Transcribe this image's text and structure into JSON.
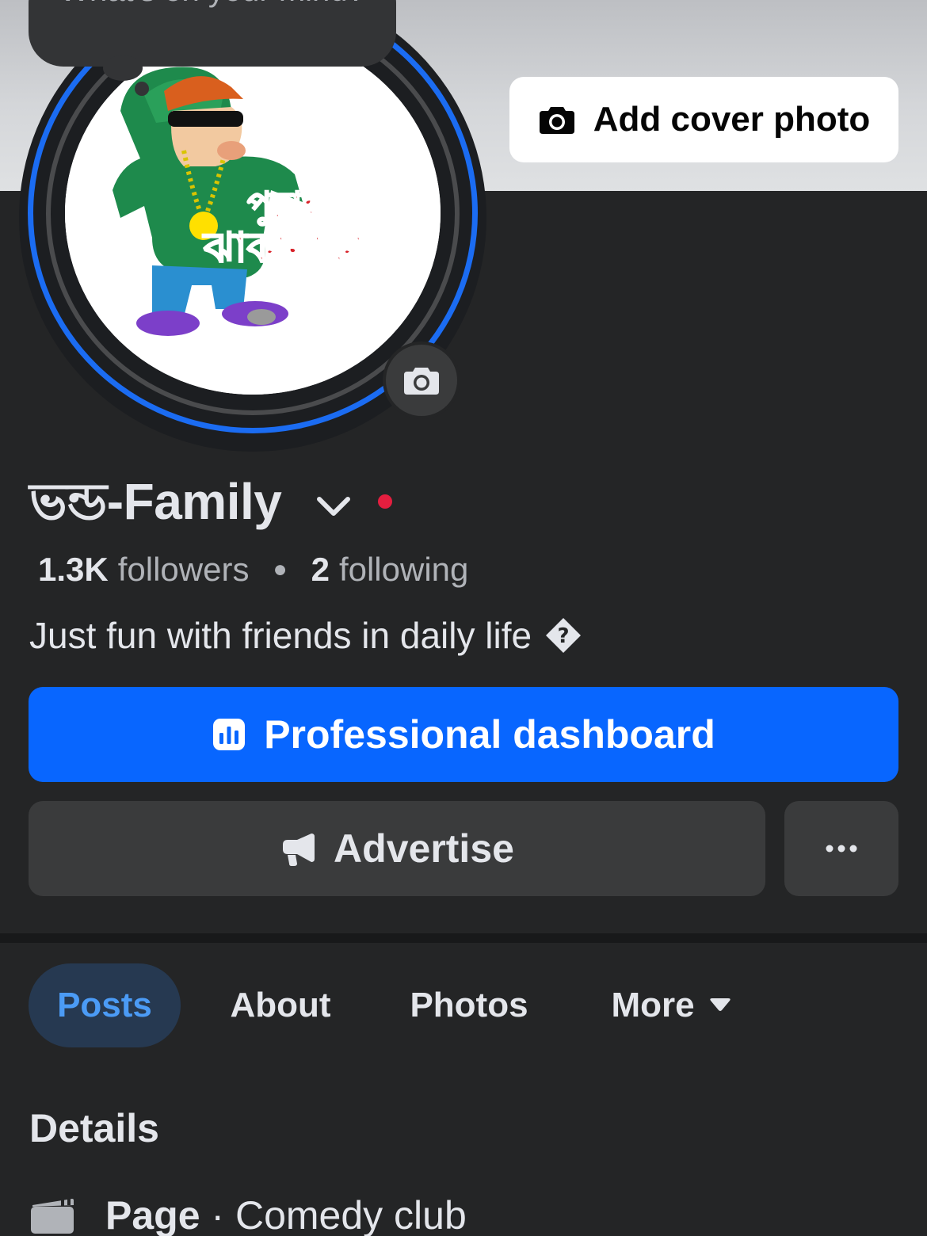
{
  "composer": {
    "placeholder": "What's on your mind?"
  },
  "cover": {
    "add_cover_label": "Add cover photo"
  },
  "profile": {
    "name": "ভন্ড-Family",
    "followers_count": "1.3K",
    "followers_label": "followers",
    "following_count": "2",
    "following_label": "following",
    "bio": "Just fun with friends in daily life"
  },
  "actions": {
    "dashboard_label": "Professional dashboard",
    "advertise_label": "Advertise"
  },
  "tabs": [
    {
      "label": "Posts",
      "active": true
    },
    {
      "label": "About"
    },
    {
      "label": "Photos"
    },
    {
      "label": "More"
    }
  ],
  "details": {
    "title": "Details",
    "category_prefix": "Page",
    "category_value": "Comedy club"
  },
  "avatar_art_text": [
    "পুরাই",
    "ঝাকানাকা"
  ],
  "colors": {
    "background": "#242526",
    "primary_blue": "#0866ff",
    "secondary_button": "#3a3b3c",
    "active_tab_bg": "#263951",
    "active_tab_text": "#4b9bf5",
    "story_ring": "#1b6cf2",
    "status_dot": "#e41e3f"
  },
  "icons": [
    "camera-icon",
    "chevron-down-icon",
    "unknown-emoji-icon",
    "dashboard-icon",
    "megaphone-icon",
    "ellipsis-icon",
    "caret-down-icon",
    "clapperboard-icon"
  ]
}
